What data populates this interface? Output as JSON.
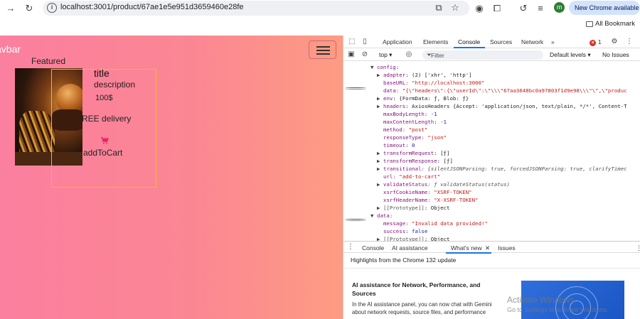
{
  "browser": {
    "url": "localhost:3001/product/67ae1e5e951d3659460e28fe",
    "profile_initial": "m",
    "new_chrome_label": "New Chrome available",
    "all_bookmarks_label": "All Bookmark",
    "icons": [
      "forward-arrow-icon",
      "reload-icon",
      "site-info-icon",
      "install-icon",
      "star-icon",
      "chrome-icon",
      "extensions-icon",
      "sync-icon",
      "reading-list-icon"
    ]
  },
  "page": {
    "navbar_brand": "avbar",
    "section_label": "Featured",
    "product": {
      "title": "title",
      "description": "description",
      "price": "100$",
      "delivery": "REE delivery",
      "add_to_cart": "addToCart"
    },
    "colors": {
      "background_left": "#fb7f9f",
      "background_right": "#fd9c82",
      "cart_icon": "#e91e63",
      "outline": "#f2b437"
    }
  },
  "devtools": {
    "tabs": [
      "Application",
      "Elements",
      "Console",
      "Sources",
      "Network"
    ],
    "active_tab": "Console",
    "more_tabs_label": "»",
    "error_count": "1",
    "filter_bar": {
      "context": "top ▾",
      "filter_placeholder": "Filter",
      "levels": "Default levels ▾",
      "issues": "No Issues"
    },
    "console_lines": [
      {
        "t": "▼",
        "key": "config",
        "rest": ":",
        "indent": 0
      },
      {
        "t": "▶",
        "key": "adapter",
        "rest": ": (2) ['xhr', 'http']",
        "indent": 1
      },
      {
        "t": "",
        "key": "baseURL",
        "rest": ": \"http://localhost:3000\"",
        "indent": 1
      },
      {
        "t": "",
        "key": "data",
        "rest": ": \"{\\\"headers\\\":{\\\"userId\\\":\\\"\\\\\\\"67aa3648bc0a97803f1d9e98\\\\\\\"\\\",\\\"produc",
        "indent": 1
      },
      {
        "t": "▶",
        "key": "env",
        "rest": ": {FormData: ƒ, Blob: ƒ}",
        "indent": 1
      },
      {
        "t": "▶",
        "key": "headers",
        "rest": ": AxiosHeaders {Accept: 'application/json, text/plain, */*', Content-T",
        "indent": 1
      },
      {
        "t": "",
        "key": "maxBodyLength",
        "rest": ": -1",
        "indent": 1
      },
      {
        "t": "",
        "key": "maxContentLength",
        "rest": ": -1",
        "indent": 1
      },
      {
        "t": "",
        "key": "method",
        "rest": ": \"post\"",
        "indent": 1
      },
      {
        "t": "",
        "key": "responseType",
        "rest": ": \"json\"",
        "indent": 1
      },
      {
        "t": "",
        "key": "timeout",
        "rest": ": 0",
        "indent": 1
      },
      {
        "t": "▶",
        "key": "transformRequest",
        "rest": ": [ƒ]",
        "indent": 1
      },
      {
        "t": "▶",
        "key": "transformResponse",
        "rest": ": [ƒ]",
        "indent": 1
      },
      {
        "t": "▶",
        "key": "transitional",
        "rest": ": {silentJSONParsing: true, forcedJSONParsing: true, clarifyTimec",
        "indent": 1
      },
      {
        "t": "",
        "key": "url",
        "rest": ": \"add-to-cart\"",
        "indent": 1
      },
      {
        "t": "▶",
        "key": "validateStatus",
        "rest": ": ƒ validateStatus(status)",
        "indent": 1
      },
      {
        "t": "",
        "key": "xsrfCookieName",
        "rest": ": \"XSRF-TOKEN\"",
        "indent": 1
      },
      {
        "t": "",
        "key": "xsrfHeaderName",
        "rest": ": \"X-XSRF-TOKEN\"",
        "indent": 1
      },
      {
        "t": "▶",
        "key": "[[Prototype]]",
        "rest": ": Object",
        "indent": 1
      },
      {
        "t": "▼",
        "key": "data",
        "rest": ":",
        "indent": 0
      },
      {
        "t": "",
        "key": "message",
        "rest": ": \"Invalid data provided!\"",
        "indent": 1
      },
      {
        "t": "",
        "key": "success",
        "rest": ": false",
        "indent": 1
      },
      {
        "t": "▶",
        "key": "[[Prototype]]",
        "rest": ": Object",
        "indent": 1
      }
    ],
    "drawer": {
      "tabs": [
        "Console",
        "AI assistance",
        "What's new",
        "Issues"
      ],
      "active_tab": "What's new",
      "highlights": "Highlights from the Chrome 132 update",
      "ai_heading": "AI assistance for Network, Performance, and Sources",
      "ai_body": "In the AI assistance panel, you can now chat with Gemini about network requests, source files, and performance"
    },
    "watermark": {
      "line1": "Activate Windows",
      "line2": "Go to Settings to activate Windows."
    }
  }
}
